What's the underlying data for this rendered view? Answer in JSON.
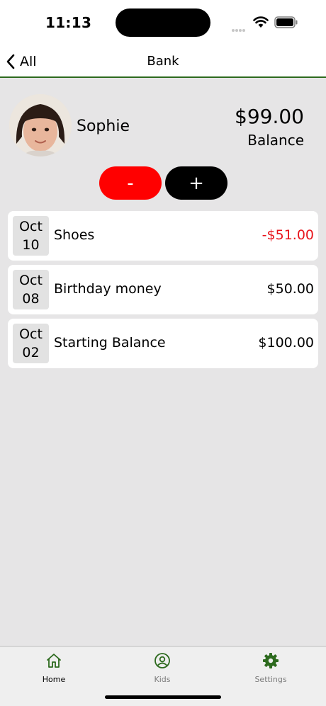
{
  "status_bar": {
    "time": "11:13"
  },
  "nav": {
    "back_label": "All",
    "title": "Bank"
  },
  "profile": {
    "name": "Sophie",
    "balance": "$99.00",
    "balance_label": "Balance"
  },
  "actions": {
    "minus_label": "-",
    "plus_label": "+"
  },
  "transactions": [
    {
      "month": "Oct",
      "day": "10",
      "description": "Shoes",
      "amount": "-$51.00",
      "negative": true
    },
    {
      "month": "Oct",
      "day": "08",
      "description": "Birthday money",
      "amount": "$50.00",
      "negative": false
    },
    {
      "month": "Oct",
      "day": "02",
      "description": "Starting Balance",
      "amount": "$100.00",
      "negative": false
    }
  ],
  "tabs": [
    {
      "label": "Home",
      "icon": "home-icon",
      "active": true
    },
    {
      "label": "Kids",
      "icon": "user-circle-icon",
      "active": false
    },
    {
      "label": "Settings",
      "icon": "gear-icon",
      "active": false
    }
  ],
  "colors": {
    "accent_green": "#2d6a1e",
    "minus_red": "#ff0000",
    "negative_text": "#e8141b",
    "background": "#e6e5e6"
  }
}
